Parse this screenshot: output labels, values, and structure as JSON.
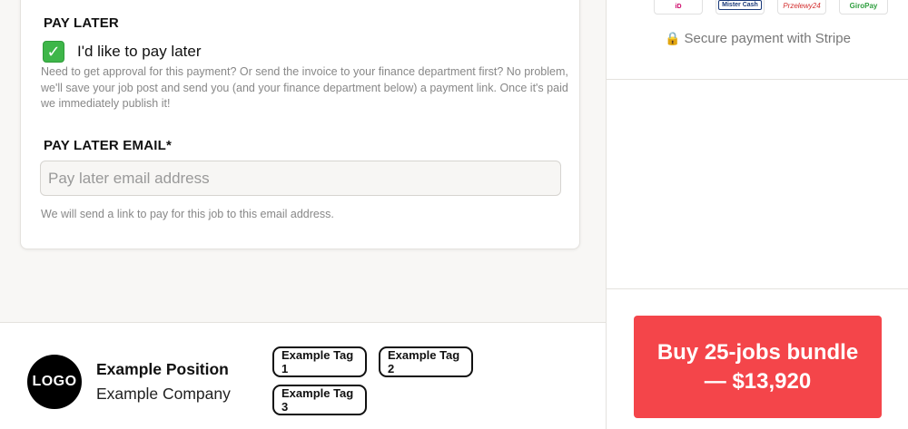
{
  "form": {
    "pay_later_heading": "PAY LATER",
    "pay_later_checkbox_label": "I'd like to pay later",
    "pay_later_checked": true,
    "pay_later_description": "Need to get approval for this payment? Or send the invoice to your finance department first? No problem, we'll save your job post and send you (and your finance department below) a payment link. Once it's paid we immediately publish it!",
    "pay_later_email_heading": "PAY LATER EMAIL*",
    "pay_later_email_placeholder": "Pay later email address",
    "pay_later_email_value": "",
    "pay_later_email_hint": "We will send a link to pay for this job to this email address."
  },
  "sidebar": {
    "payment_methods": [
      {
        "icon": "ideal-logo-icon",
        "label": "iD"
      },
      {
        "icon": "mister-cash-logo-icon",
        "label": "Mister Cash"
      },
      {
        "icon": "przelewy24-logo-icon",
        "label": "Przelewy24"
      },
      {
        "icon": "giropay-logo-icon",
        "label": "GiroPay"
      }
    ],
    "secure_text": "Secure payment with Stripe",
    "secure_icon": "lock-icon",
    "buy_button_label": "Buy 25-jobs bundle — $13,920",
    "buy_button_color": "#f4454a"
  },
  "preview": {
    "logo_text": "LOGO",
    "position_title": "Example Position",
    "company_name": "Example Company",
    "tags": [
      "Example Tag 1",
      "Example Tag 2",
      "Example Tag 3"
    ]
  },
  "colors": {
    "accent": "#f4454a",
    "checkbox_green": "#3eb649",
    "muted_text": "#888888"
  }
}
